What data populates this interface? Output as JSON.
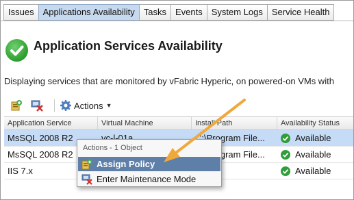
{
  "tabs": [
    {
      "label": "Issues"
    },
    {
      "label": "Applications Availability"
    },
    {
      "label": "Tasks"
    },
    {
      "label": "Events"
    },
    {
      "label": "System Logs"
    },
    {
      "label": "Service Health"
    }
  ],
  "header": {
    "title": "Application Services Availability",
    "description": "Displaying services that are monitored by vFabric Hyperic, on powered-on VMs with"
  },
  "toolbar": {
    "assign_icon": "assign-policy-icon",
    "maintenance_icon": "maintenance-mode-icon",
    "actions_label": "Actions",
    "actions_icon": "gear-icon"
  },
  "table": {
    "columns": [
      "Application Service",
      "Virtual Machine",
      "Install Path",
      "Availability Status"
    ],
    "rows": [
      {
        "service": "MsSQL 2008 R2",
        "vm": "vc-l-01a",
        "path": "C:\\Program File...",
        "status": "Available",
        "selected": true
      },
      {
        "service": "MsSQL 2008 R2",
        "vm": "",
        "path": "C:\\Program File...",
        "status": "Available",
        "selected": false
      },
      {
        "service": "IIS 7.x",
        "vm": "",
        "path": "",
        "status": "Available",
        "selected": false
      }
    ]
  },
  "context_menu": {
    "header": "Actions - 1 Object",
    "items": [
      {
        "label": "Assign Policy",
        "icon": "assign-policy-icon",
        "highlighted": true
      },
      {
        "label": "Enter Maintenance Mode",
        "icon": "maintenance-mode-icon",
        "highlighted": false
      }
    ]
  },
  "colors": {
    "active_tab": "#c7d9ee",
    "selected_row": "#c6dbf5",
    "menu_highlight": "#5e7fa8",
    "status_ok": "#2f9e3a",
    "annotation_arrow": "#f0a83a"
  }
}
